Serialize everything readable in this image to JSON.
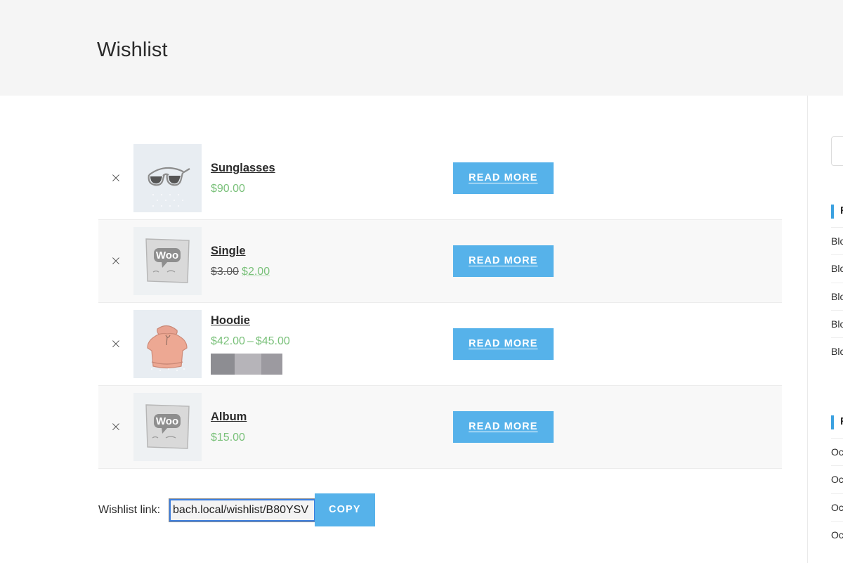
{
  "page": {
    "title": "Wishlist"
  },
  "wishlist": {
    "remove_icon": "close-x-icon",
    "rows": [
      {
        "remove_label": "×",
        "thumb_icon": "sunglasses-thumbnail",
        "name": "Sunglasses",
        "price_type": "single",
        "price": "$90.00",
        "has_swatches": false,
        "action_label": "READ MORE"
      },
      {
        "remove_label": "×",
        "thumb_icon": "woo-single-thumbnail",
        "name": "Single",
        "price_type": "sale",
        "price_old": "$3.00",
        "price_sale": "$2.00",
        "has_swatches": false,
        "action_label": "READ MORE"
      },
      {
        "remove_label": "×",
        "thumb_icon": "hoodie-thumbnail",
        "name": "Hoodie",
        "price_type": "range",
        "price_min": "$42.00",
        "price_dash": "–",
        "price_max": "$45.00",
        "has_swatches": true,
        "action_label": "READ MORE"
      },
      {
        "remove_label": "×",
        "thumb_icon": "woo-album-thumbnail",
        "name": "Album",
        "price_type": "single",
        "price": "$15.00",
        "has_swatches": false,
        "action_label": "READ MORE"
      }
    ]
  },
  "share": {
    "label": "Wishlist link:",
    "link_value": "bach.local/wishlist/B80YSV",
    "link_placeholder": "bach.local/wishlist/B80YSV",
    "copy_label": "COPY"
  },
  "sidebar": {
    "search_placeholder": "",
    "blocks": [
      {
        "heading": "Recent Posts",
        "items": [
          "Blog post",
          "Blog post",
          "Blog post",
          "Blog post",
          "Blog post"
        ]
      },
      {
        "heading": "Recent Comments",
        "items": [
          "October commen ting",
          "October",
          "October",
          "October"
        ]
      }
    ]
  },
  "colors": {
    "accent_blue": "#56b2ea",
    "price_green": "#7ac17a",
    "header_band": "#f5f5f5",
    "row_alt": "#f8f8f8",
    "thumb_bg": "#e8edf2"
  }
}
